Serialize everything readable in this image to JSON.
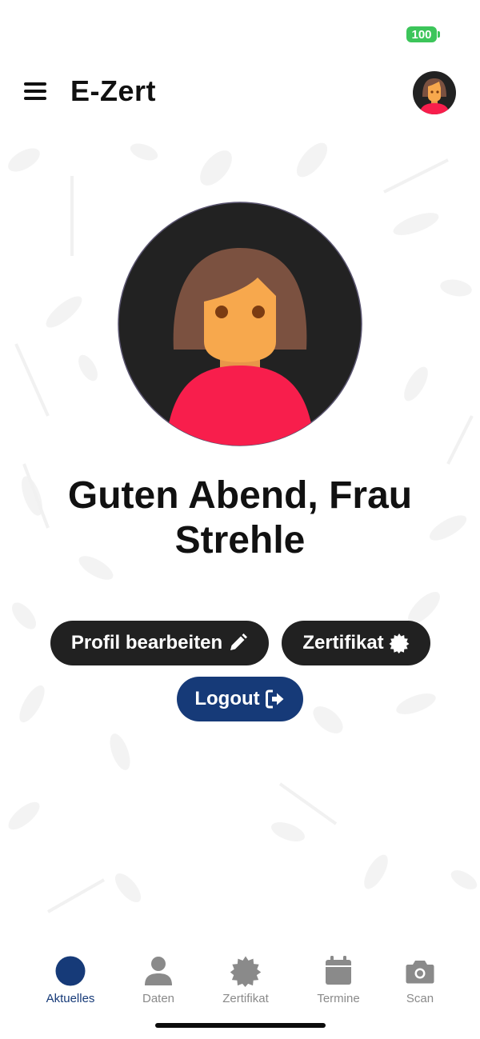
{
  "status": {
    "battery": "100",
    "battery_color": "#3cc55a"
  },
  "header": {
    "title": "E-Zert",
    "menu_icon": "hamburger-icon",
    "avatar_icon": "female-avatar-icon"
  },
  "profile": {
    "greeting": "Guten Abend, Frau Strehle"
  },
  "actions": {
    "edit_label": "Profil bearbeiten",
    "edit_icon": "pencil-icon",
    "cert_label": "Zertifikat",
    "cert_icon": "badge-icon",
    "logout_label": "Logout",
    "logout_icon": "sign-out-icon"
  },
  "tabs": [
    {
      "label": "Aktuelles",
      "icon": "circle-icon",
      "active": true
    },
    {
      "label": "Daten",
      "icon": "user-icon",
      "active": false
    },
    {
      "label": "Zertifikat",
      "icon": "badge-icon",
      "active": false
    },
    {
      "label": "Termine",
      "icon": "calendar-icon",
      "active": false
    },
    {
      "label": "Scan",
      "icon": "camera-icon",
      "active": false
    }
  ],
  "colors": {
    "primary": "#163a78",
    "dark_button": "#212121",
    "inactive_tab": "#8a8a8a"
  }
}
